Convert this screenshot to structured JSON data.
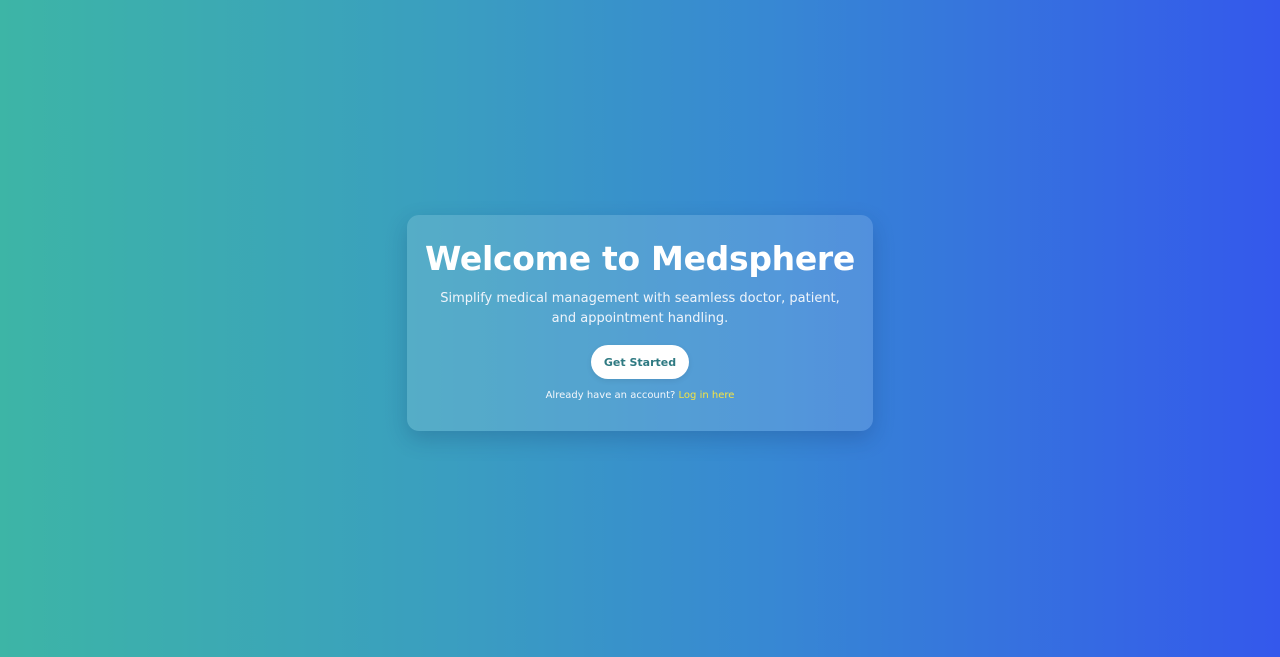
{
  "hero": {
    "title": "Welcome to Medsphere",
    "subtitle_line1": "Simplify medical management with seamless doctor, patient,",
    "subtitle_line2": "and appointment handling.",
    "cta_label": "Get Started",
    "login_prompt": "Already have an account?",
    "login_link_label": "Log in here"
  },
  "colors": {
    "gradient_start": "#3db5a6",
    "gradient_end": "#3458ec",
    "button_text": "#2f7a82",
    "link": "#f5e442"
  }
}
